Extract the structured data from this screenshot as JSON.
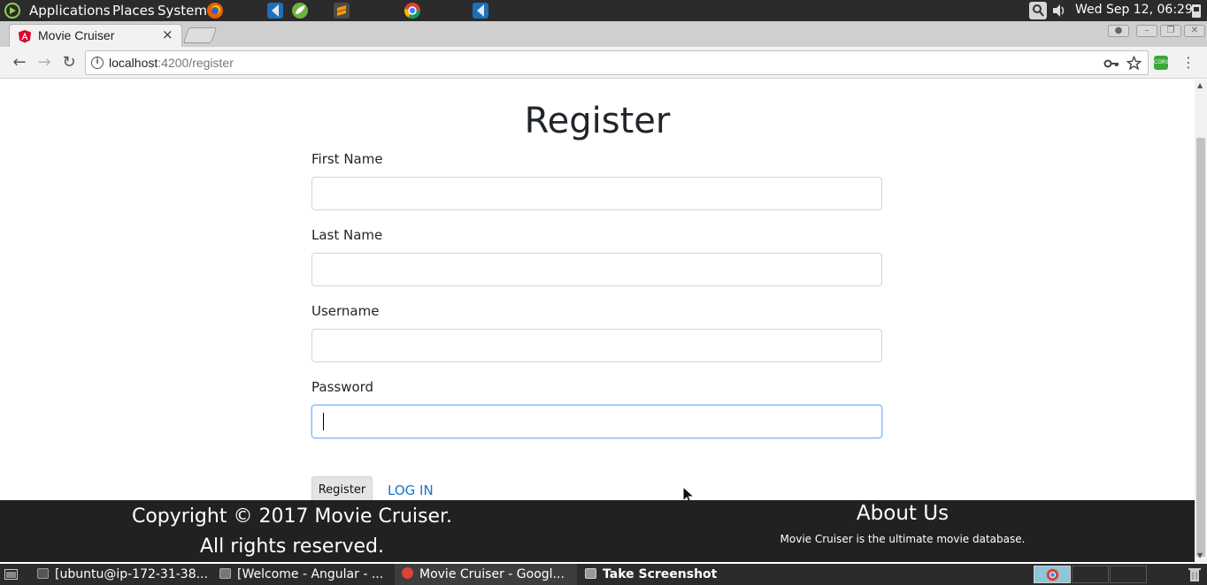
{
  "system_panel": {
    "menus": [
      "Applications",
      "Places",
      "System"
    ],
    "clock": "Wed Sep 12, 06:29"
  },
  "browser": {
    "tab_title": "Movie Cruiser",
    "tab_close": "×",
    "url_host": "localhost",
    "url_path": ":4200/register",
    "extension_label": "CORS"
  },
  "page": {
    "title": "Register",
    "fields": [
      {
        "label": "First Name",
        "value": ""
      },
      {
        "label": "Last Name",
        "value": ""
      },
      {
        "label": "Username",
        "value": ""
      },
      {
        "label": "Password",
        "value": ""
      }
    ],
    "register_label": "Register",
    "login_label": "LOG IN"
  },
  "footer": {
    "copyright_line1": "Copyright © 2017 Movie Cruiser.",
    "copyright_line2": "All rights reserved.",
    "about_title": "About Us",
    "about_text": "Movie Cruiser is the ultimate movie database."
  },
  "taskbar": {
    "tasks": [
      {
        "label": "[ubuntu@ip-172-31-38..."
      },
      {
        "label": "[Welcome - Angular - ..."
      },
      {
        "label": "Movie Cruiser - Googl..."
      },
      {
        "label": "Take Screenshot"
      }
    ]
  },
  "colors": {
    "link": "#1a73c9",
    "footer_bg": "#212121",
    "focus_border": "#80bdff"
  }
}
